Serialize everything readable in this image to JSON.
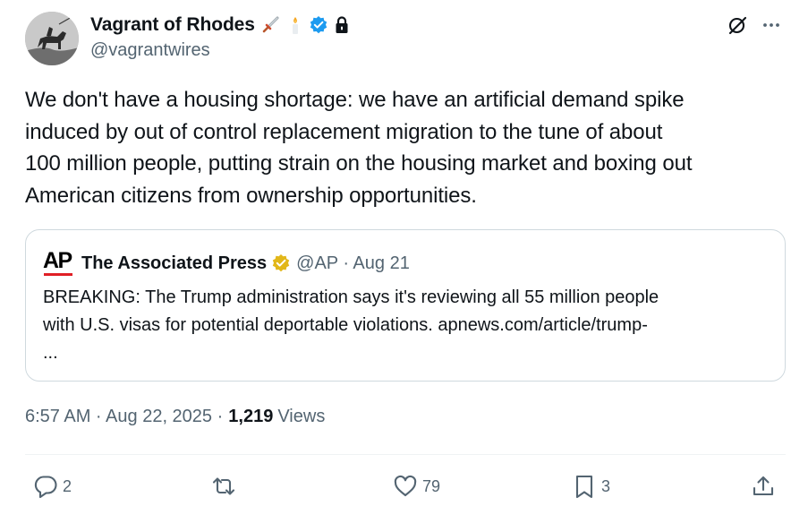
{
  "author": {
    "display_name": "Vagrant of Rhodes",
    "handle": "@vagrantwires",
    "emoji_icons": [
      "dagger-icon",
      "candle-icon"
    ],
    "verified_icon": "blue-verified-badge-icon",
    "lock_icon": "lock-icon"
  },
  "header_actions": {
    "grok_icon": "grok-icon",
    "more_icon": "more-dots-icon"
  },
  "tweet": {
    "text_lines": [
      "We don't have a housing shortage: we have an artificial demand spike",
      "induced by out of control replacement migration to the tune of about",
      "100 million people, putting strain on the housing market and boxing out",
      "American citizens from ownership opportunities."
    ]
  },
  "quote": {
    "logo_text": "AP",
    "name": "The Associated Press",
    "badge_icon": "gold-verified-badge-icon",
    "meta": "@AP · Aug 21",
    "body_lines": [
      "BREAKING: The Trump administration says it's reviewing all 55 million people",
      "with U.S. visas for potential deportable violations. apnews.com/article/trump-",
      "..."
    ]
  },
  "meta": {
    "timestamp": "6:57 AM · Aug 22, 2025 ·",
    "views_count": "1,219",
    "views_label": "Views"
  },
  "actions": {
    "reply_count": "2",
    "retweet_count": "",
    "like_count": "79",
    "bookmark_count": "3",
    "share_count": ""
  },
  "colors": {
    "text": "#0f1419",
    "secondary": "#536471",
    "verified_blue": "#1d9bf0",
    "gold": "#e2b719",
    "ap_red": "#e01f26",
    "border": "#cfd9de"
  }
}
